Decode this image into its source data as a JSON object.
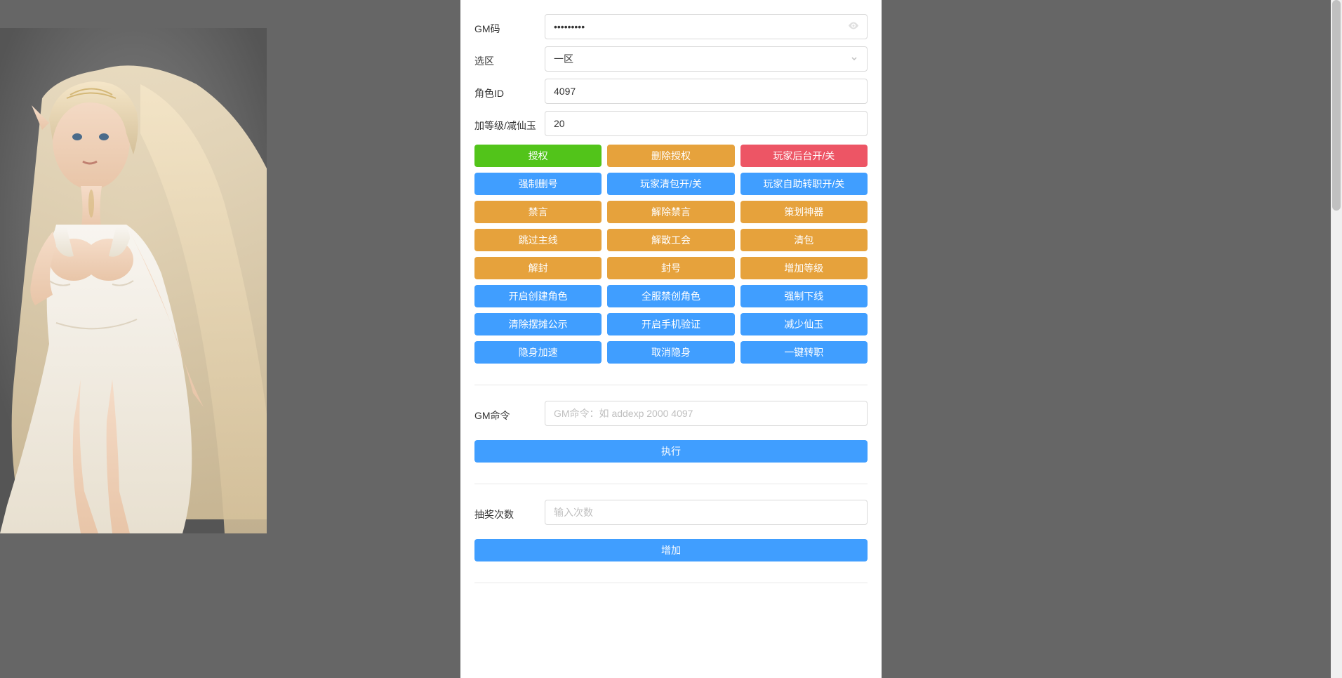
{
  "labels": {
    "gm_code": "GM码",
    "zone": "选区",
    "role_id": "角色ID",
    "level_jade": "加等级/减仙玉",
    "gm_command": "GM命令",
    "lottery_count": "抽奖次数"
  },
  "values": {
    "gm_code": "•••••••••",
    "zone": "一区",
    "role_id": "4097",
    "level_jade": "20"
  },
  "placeholders": {
    "gm_command": "GM命令：如 addexp 2000 4097",
    "lottery_count": "输入次数"
  },
  "buttons": {
    "row1": [
      "授权",
      "删除授权",
      "玩家后台开/关"
    ],
    "row2": [
      "强制删号",
      "玩家清包开/关",
      "玩家自助转职开/关"
    ],
    "row3": [
      "禁言",
      "解除禁言",
      "策划神器"
    ],
    "row4": [
      "跳过主线",
      "解散工会",
      "清包"
    ],
    "row5": [
      "解封",
      "封号",
      "增加等级"
    ],
    "row6": [
      "开启创建角色",
      "全服禁创角色",
      "强制下线"
    ],
    "row7": [
      "清除摆摊公示",
      "开启手机验证",
      "减少仙玉"
    ],
    "row8": [
      "隐身加速",
      "取消隐身",
      "一键转职"
    ],
    "execute": "执行",
    "add": "增加"
  }
}
